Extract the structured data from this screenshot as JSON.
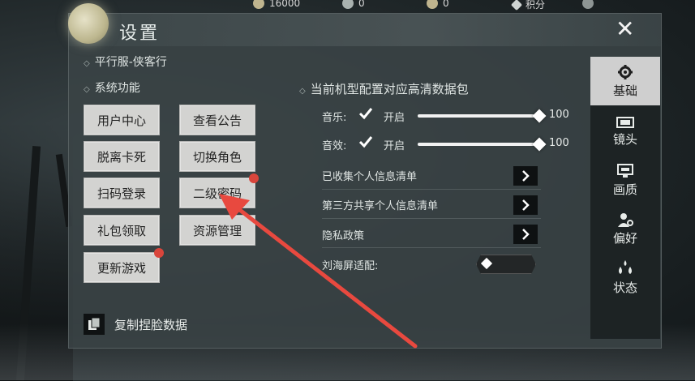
{
  "currency": [
    {
      "icon": "coin-icon",
      "value": "16000"
    },
    {
      "icon": "gem-icon",
      "value": "0"
    },
    {
      "icon": "token-icon",
      "value": "0"
    },
    {
      "icon": "points-icon",
      "value": "积分"
    }
  ],
  "window": {
    "title": "设置"
  },
  "left": {
    "server_name": "平行服-侠客行",
    "section_title": "系统功能",
    "buttons": [
      "用户中心",
      "查看公告",
      "脱离卡死",
      "切换角色",
      "扫码登录",
      "二级密码",
      "礼包领取",
      "资源管理",
      "更新游戏"
    ],
    "copy_label": "复制捏脸数据"
  },
  "right": {
    "section_title": "当前机型配置对应高清数据包",
    "music_label": "音乐:",
    "sfx_label": "音效:",
    "enable_label": "开启",
    "music_value": "100",
    "sfx_value": "100",
    "music_level": 1.0,
    "sfx_level": 1.0,
    "links": [
      "已收集个人信息清单",
      "第三方共享个人信息清单",
      "隐私政策"
    ],
    "notch_label": "刘海屏适配:",
    "notch_enabled": false
  },
  "tabs": [
    {
      "label": "基础",
      "icon": "gear-icon",
      "active": true
    },
    {
      "label": "镜头",
      "icon": "film-icon",
      "active": false
    },
    {
      "label": "画质",
      "icon": "monitor-icon",
      "active": false
    },
    {
      "label": "偏好",
      "icon": "user-settings-icon",
      "active": false
    },
    {
      "label": "状态",
      "icon": "drops-icon",
      "active": false
    }
  ],
  "colors": {
    "notify_dot": "#d9453b",
    "arrow": "#e8493f",
    "active_tab": "#cfcfcf"
  }
}
